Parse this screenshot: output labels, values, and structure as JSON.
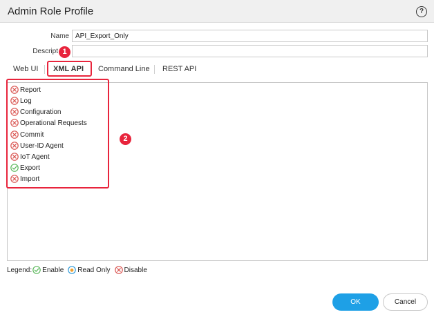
{
  "dialog": {
    "title": "Admin Role Profile",
    "help_glyph": "?"
  },
  "form": {
    "name_label": "Name",
    "name_value": "API_Export_Only",
    "description_label": "Descript",
    "description_value": ""
  },
  "tabs": [
    {
      "label": "Web UI",
      "active": false
    },
    {
      "label": "XML API",
      "active": true
    },
    {
      "label": "Command Line",
      "active": false
    },
    {
      "label": "REST API",
      "active": false
    }
  ],
  "permissions": [
    {
      "label": "Report",
      "state": "disable",
      "icon": "disable-icon"
    },
    {
      "label": "Log",
      "state": "disable",
      "icon": "disable-icon"
    },
    {
      "label": "Configuration",
      "state": "disable",
      "icon": "disable-icon"
    },
    {
      "label": "Operational Requests",
      "state": "disable",
      "icon": "disable-icon"
    },
    {
      "label": "Commit",
      "state": "disable",
      "icon": "disable-icon"
    },
    {
      "label": "User-ID Agent",
      "state": "disable",
      "icon": "disable-icon"
    },
    {
      "label": "IoT Agent",
      "state": "disable",
      "icon": "disable-icon"
    },
    {
      "label": "Export",
      "state": "enable",
      "icon": "enable-icon"
    },
    {
      "label": "Import",
      "state": "disable",
      "icon": "disable-icon"
    }
  ],
  "legend": {
    "prefix": "Legend:",
    "enable": "Enable",
    "read_only": "Read Only",
    "disable": "Disable"
  },
  "annotations": {
    "badge_1": "1",
    "badge_2": "2",
    "color": "#e8243c"
  },
  "buttons": {
    "ok": "OK",
    "cancel": "Cancel"
  },
  "colors": {
    "accent": "#1ea0e6",
    "enable": "#5cb85c",
    "disable": "#d9534f",
    "read_only": "#2f9ad8"
  }
}
